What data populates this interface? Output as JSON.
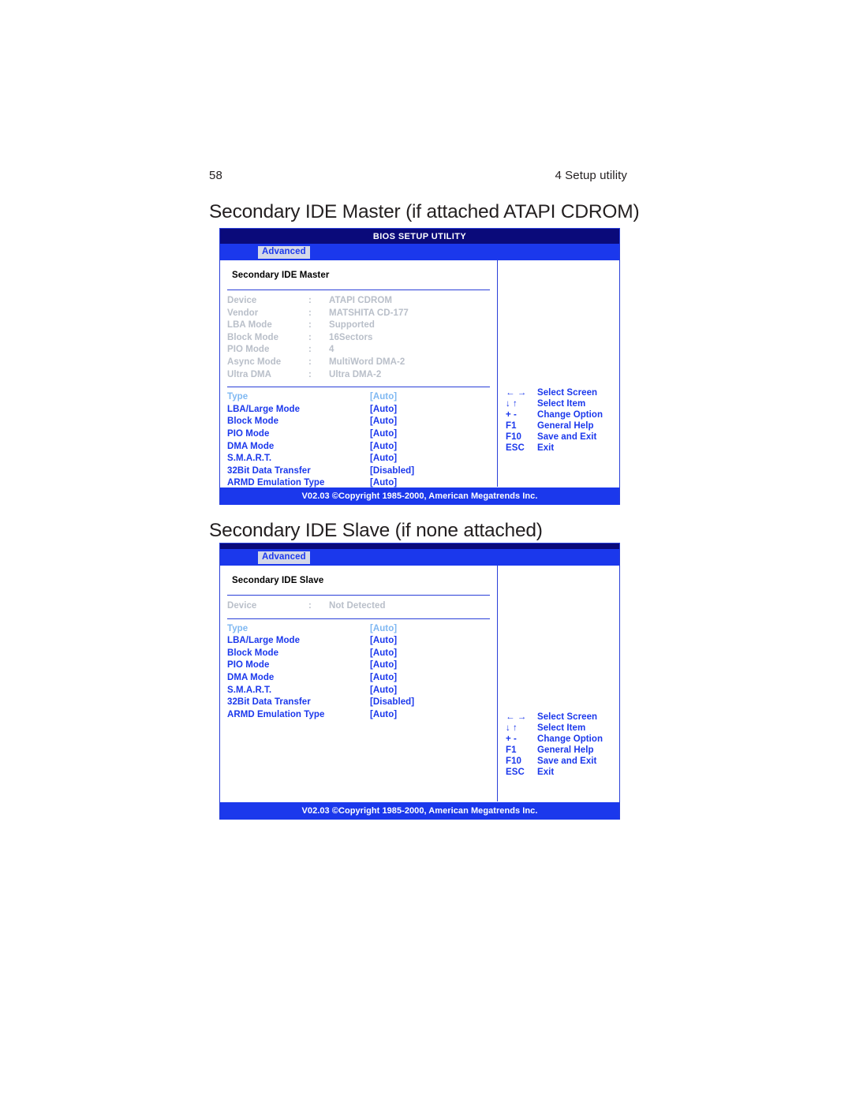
{
  "page": {
    "folio": "58",
    "chapter_title": "4 Setup utility"
  },
  "sections": [
    {
      "heading": "Secondary IDE Master (if attached ATAPI CDROM)",
      "screen": {
        "title_bar": "BIOS SETUP UTILITY",
        "menu_tab": "Advanced",
        "panel_title": "Secondary IDE Master",
        "info_rows": [
          {
            "label": "Device",
            "sep": ":",
            "value": "ATAPI CDROM"
          },
          {
            "label": "Vendor",
            "sep": ":",
            "value": "MATSHITA CD-177"
          },
          {
            "label": "LBA Mode",
            "sep": ":",
            "value": "Supported"
          },
          {
            "label": "Block Mode",
            "sep": ":",
            "value": "16Sectors"
          },
          {
            "label": "PIO Mode",
            "sep": ":",
            "value": "4"
          },
          {
            "label": "Async Mode",
            "sep": ":",
            "value": "MultiWord DMA-2"
          },
          {
            "label": "Ultra DMA",
            "sep": ":",
            "value": "Ultra DMA-2"
          }
        ],
        "settings": [
          {
            "label": "Type",
            "value": "[Auto]",
            "dim": true
          },
          {
            "label": "LBA/Large Mode",
            "value": "[Auto]",
            "dim": false
          },
          {
            "label": "Block Mode",
            "value": "[Auto]",
            "dim": false
          },
          {
            "label": "PIO Mode",
            "value": "[Auto]",
            "dim": false
          },
          {
            "label": "DMA Mode",
            "value": "[Auto]",
            "dim": false
          },
          {
            "label": "S.M.A.R.T.",
            "value": "[Auto]",
            "dim": false
          },
          {
            "label": "32Bit Data Transfer",
            "value": "[Disabled]",
            "dim": false
          },
          {
            "label": "ARMD Emulation Type",
            "value": "[Auto]",
            "dim": false
          }
        ],
        "nav_keys": [
          {
            "key": "← →",
            "label": "Select Screen"
          },
          {
            "key": "↓ ↑",
            "label": "Select Item"
          },
          {
            "key": "+ -",
            "label": "Change Option"
          },
          {
            "key": "F1",
            "label": "General Help"
          },
          {
            "key": "F10",
            "label": "Save and Exit"
          },
          {
            "key": "ESC",
            "label": "Exit"
          }
        ],
        "footer": "V02.03 ©Copyright 1985-2000, American Megatrends Inc."
      }
    },
    {
      "heading": "Secondary IDE Slave (if none attached)",
      "screen": {
        "title_bar": "",
        "menu_tab": "Advanced",
        "panel_title": "Secondary IDE Slave",
        "info_rows": [
          {
            "label": "Device",
            "sep": ":",
            "value": "Not Detected"
          }
        ],
        "settings": [
          {
            "label": "Type",
            "value": "[Auto]",
            "dim": true
          },
          {
            "label": "LBA/Large Mode",
            "value": "[Auto]",
            "dim": false
          },
          {
            "label": "Block Mode",
            "value": "[Auto]",
            "dim": false
          },
          {
            "label": "PIO Mode",
            "value": "[Auto]",
            "dim": false
          },
          {
            "label": "DMA Mode",
            "value": "[Auto]",
            "dim": false
          },
          {
            "label": "S.M.A.R.T.",
            "value": "[Auto]",
            "dim": false
          },
          {
            "label": "32Bit Data Transfer",
            "value": "[Disabled]",
            "dim": false
          },
          {
            "label": "ARMD Emulation Type",
            "value": "[Auto]",
            "dim": false
          }
        ],
        "nav_keys": [
          {
            "key": "← →",
            "label": "Select Screen"
          },
          {
            "key": "↓ ↑",
            "label": "Select Item"
          },
          {
            "key": "+ -",
            "label": "Change Option"
          },
          {
            "key": "F1",
            "label": "General Help"
          },
          {
            "key": "F10",
            "label": "Save and Exit"
          },
          {
            "key": "ESC",
            "label": "Exit"
          }
        ],
        "footer": "V02.03 ©Copyright 1985-2000, American Megatrends Inc."
      }
    }
  ],
  "colors": {
    "title_bar": "#0a0a7a",
    "menu_bar": "#1b38ec",
    "accent_blue": "#1b38ec",
    "dim_gray": "#b9bfc9",
    "dim_blue": "#7fb8f2",
    "text_black": "#231f20"
  }
}
